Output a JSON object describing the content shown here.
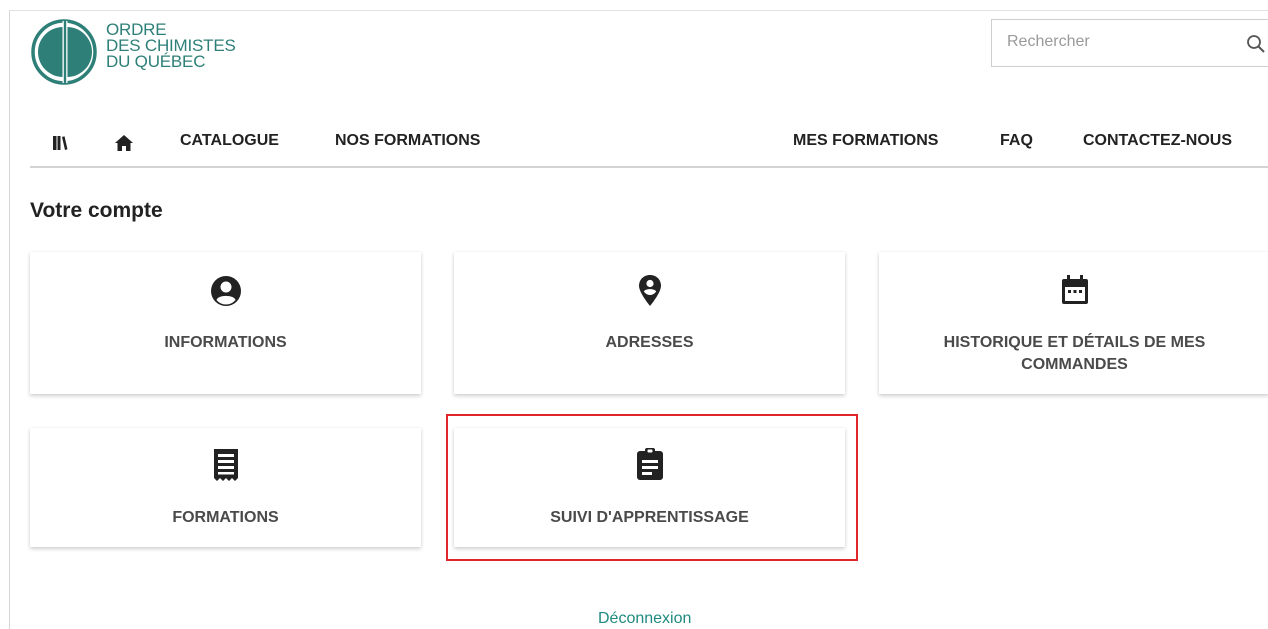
{
  "brand": {
    "logo_lines": [
      "ORDRE",
      "DES CHIMISTES",
      "DU QUÉBEC"
    ],
    "color": "#2e7f78"
  },
  "search": {
    "placeholder": "Rechercher",
    "icon": "search-icon"
  },
  "nav": {
    "left_icons": [
      "library-icon",
      "home-icon"
    ],
    "items": [
      {
        "label": "CATALOGUE"
      },
      {
        "label": "NOS FORMATIONS"
      },
      {
        "label": "MES FORMATIONS"
      },
      {
        "label": "FAQ"
      },
      {
        "label": "CONTACTEZ-NOUS"
      }
    ]
  },
  "page": {
    "title": "Votre compte"
  },
  "cards": [
    {
      "label": "INFORMATIONS",
      "icon": "user-circle-icon"
    },
    {
      "label": "ADRESSES",
      "icon": "map-marker-icon"
    },
    {
      "label": "HISTORIQUE ET DÉTAILS DE MES COMMANDES",
      "icon": "calendar-icon"
    },
    {
      "label": "FORMATIONS",
      "icon": "receipt-icon"
    },
    {
      "label": "SUIVI D'APPRENTISSAGE",
      "icon": "clipboard-icon"
    }
  ],
  "highlight_color": "#e0262b",
  "footer": {
    "logout_label": "Déconnexion",
    "link_color": "#1f8a7f"
  }
}
